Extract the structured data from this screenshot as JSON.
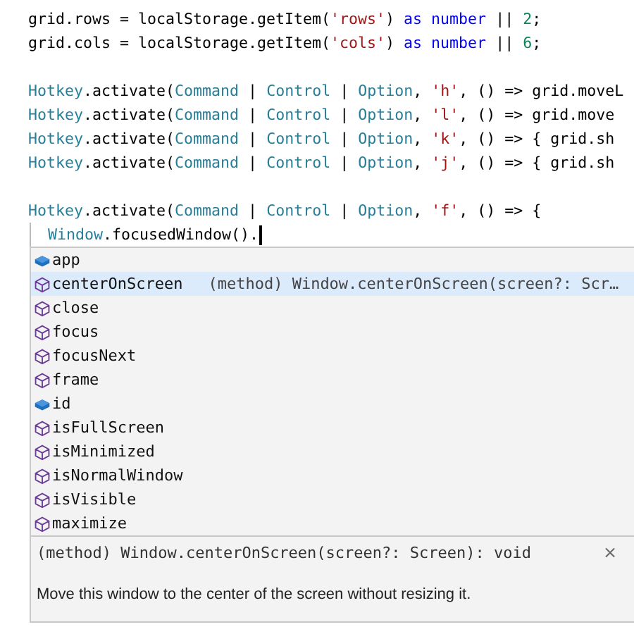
{
  "editor": {
    "lines": [
      {
        "kind": "code",
        "tokens": [
          {
            "kind": "plain",
            "text": "grid.rows = localStorage.getItem("
          },
          {
            "kind": "string",
            "text": "'rows'"
          },
          {
            "kind": "plain",
            "text": ") "
          },
          {
            "kind": "keyword",
            "text": "as number"
          },
          {
            "kind": "plain",
            "text": " || "
          },
          {
            "kind": "number",
            "text": "2"
          },
          {
            "kind": "plain",
            "text": ";"
          }
        ]
      },
      {
        "kind": "code",
        "tokens": [
          {
            "kind": "plain",
            "text": "grid.cols = localStorage.getItem("
          },
          {
            "kind": "string",
            "text": "'cols'"
          },
          {
            "kind": "plain",
            "text": ") "
          },
          {
            "kind": "keyword",
            "text": "as number"
          },
          {
            "kind": "plain",
            "text": " || "
          },
          {
            "kind": "number",
            "text": "6"
          },
          {
            "kind": "plain",
            "text": ";"
          }
        ]
      },
      {
        "kind": "blank"
      },
      {
        "kind": "code",
        "tokens": [
          {
            "kind": "type",
            "text": "Hotkey"
          },
          {
            "kind": "plain",
            "text": ".activate("
          },
          {
            "kind": "type",
            "text": "Command"
          },
          {
            "kind": "plain",
            "text": " | "
          },
          {
            "kind": "type",
            "text": "Control"
          },
          {
            "kind": "plain",
            "text": " | "
          },
          {
            "kind": "type",
            "text": "Option"
          },
          {
            "kind": "plain",
            "text": ", "
          },
          {
            "kind": "string",
            "text": "'h'"
          },
          {
            "kind": "plain",
            "text": ", () => grid.moveL"
          }
        ]
      },
      {
        "kind": "code",
        "tokens": [
          {
            "kind": "type",
            "text": "Hotkey"
          },
          {
            "kind": "plain",
            "text": ".activate("
          },
          {
            "kind": "type",
            "text": "Command"
          },
          {
            "kind": "plain",
            "text": " | "
          },
          {
            "kind": "type",
            "text": "Control"
          },
          {
            "kind": "plain",
            "text": " | "
          },
          {
            "kind": "type",
            "text": "Option"
          },
          {
            "kind": "plain",
            "text": ", "
          },
          {
            "kind": "string",
            "text": "'l'"
          },
          {
            "kind": "plain",
            "text": ", () => grid.move"
          }
        ]
      },
      {
        "kind": "code",
        "tokens": [
          {
            "kind": "type",
            "text": "Hotkey"
          },
          {
            "kind": "plain",
            "text": ".activate("
          },
          {
            "kind": "type",
            "text": "Command"
          },
          {
            "kind": "plain",
            "text": " | "
          },
          {
            "kind": "type",
            "text": "Control"
          },
          {
            "kind": "plain",
            "text": " | "
          },
          {
            "kind": "type",
            "text": "Option"
          },
          {
            "kind": "plain",
            "text": ", "
          },
          {
            "kind": "string",
            "text": "'k'"
          },
          {
            "kind": "plain",
            "text": ", () => { grid.sh"
          }
        ]
      },
      {
        "kind": "code",
        "tokens": [
          {
            "kind": "type",
            "text": "Hotkey"
          },
          {
            "kind": "plain",
            "text": ".activate("
          },
          {
            "kind": "type",
            "text": "Command"
          },
          {
            "kind": "plain",
            "text": " | "
          },
          {
            "kind": "type",
            "text": "Control"
          },
          {
            "kind": "plain",
            "text": " | "
          },
          {
            "kind": "type",
            "text": "Option"
          },
          {
            "kind": "plain",
            "text": ", "
          },
          {
            "kind": "string",
            "text": "'j'"
          },
          {
            "kind": "plain",
            "text": ", () => { grid.sh"
          }
        ]
      },
      {
        "kind": "blank"
      },
      {
        "kind": "code",
        "tokens": [
          {
            "kind": "type",
            "text": "Hotkey"
          },
          {
            "kind": "plain",
            "text": ".activate("
          },
          {
            "kind": "type",
            "text": "Command"
          },
          {
            "kind": "plain",
            "text": " | "
          },
          {
            "kind": "type",
            "text": "Control"
          },
          {
            "kind": "plain",
            "text": " | "
          },
          {
            "kind": "type",
            "text": "Option"
          },
          {
            "kind": "plain",
            "text": ", "
          },
          {
            "kind": "string",
            "text": "'f'"
          },
          {
            "kind": "plain",
            "text": ", () => {"
          }
        ]
      },
      {
        "kind": "code",
        "indented": true,
        "cursor": true,
        "tokens": [
          {
            "kind": "type",
            "text": "Window"
          },
          {
            "kind": "plain",
            "text": ".focusedWindow()."
          }
        ]
      }
    ]
  },
  "suggestions": {
    "items": [
      {
        "kind": "property",
        "label": "app",
        "selected": false
      },
      {
        "kind": "method",
        "label": "centerOnScreen",
        "selected": true,
        "detail": "(method) Window.centerOnScreen(screen?: Scr…"
      },
      {
        "kind": "method",
        "label": "close",
        "selected": false
      },
      {
        "kind": "method",
        "label": "focus",
        "selected": false
      },
      {
        "kind": "method",
        "label": "focusNext",
        "selected": false
      },
      {
        "kind": "method",
        "label": "frame",
        "selected": false
      },
      {
        "kind": "property",
        "label": "id",
        "selected": false
      },
      {
        "kind": "method",
        "label": "isFullScreen",
        "selected": false
      },
      {
        "kind": "method",
        "label": "isMinimized",
        "selected": false
      },
      {
        "kind": "method",
        "label": "isNormalWindow",
        "selected": false
      },
      {
        "kind": "method",
        "label": "isVisible",
        "selected": false
      },
      {
        "kind": "method",
        "label": "maximize",
        "selected": false
      }
    ],
    "details": {
      "signature": "(method) Window.centerOnScreen(screen?: Screen): void",
      "close": "×",
      "description": "Move this window to the center of the screen without resizing it."
    }
  }
}
